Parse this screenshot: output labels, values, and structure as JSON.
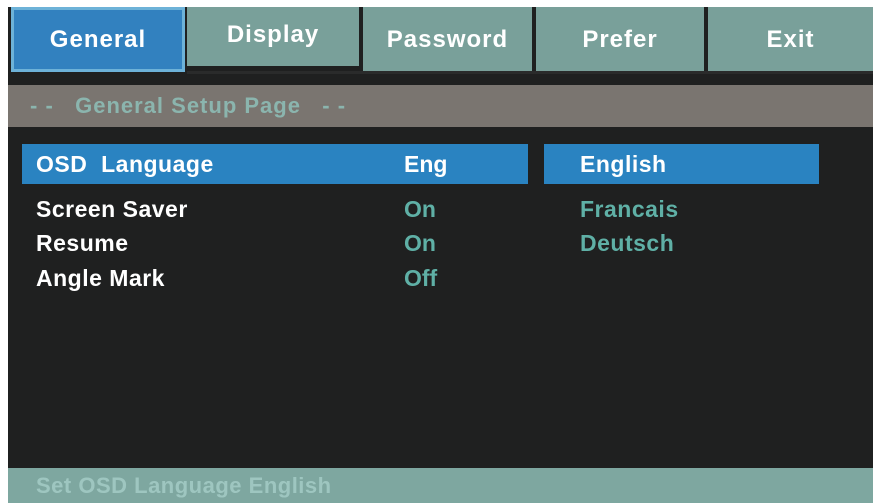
{
  "tabs": [
    {
      "label": "General",
      "active": true
    },
    {
      "label": "Display",
      "active": false
    },
    {
      "label": "Password",
      "active": false
    },
    {
      "label": "Prefer",
      "active": false
    },
    {
      "label": "Exit",
      "active": false
    }
  ],
  "page_header": "- -   General Setup Page   - -",
  "settings": [
    {
      "label": "OSD  Language",
      "value": "Eng",
      "selected": true
    },
    {
      "label": "Screen Saver",
      "value": "On",
      "selected": false
    },
    {
      "label": "Resume",
      "value": "On",
      "selected": false
    },
    {
      "label": "Angle Mark",
      "value": "Off",
      "selected": false
    }
  ],
  "options": [
    {
      "label": "English",
      "selected": true
    },
    {
      "label": "Francais",
      "selected": false
    },
    {
      "label": "Deutsch",
      "selected": false
    }
  ],
  "status_text": "Set OSD Language English",
  "colors": {
    "background": "#1f2020",
    "active_tab": "#3281bf",
    "inactive_tab": "#79a09a",
    "header_bar": "#7a7570",
    "highlight": "#2a83c1",
    "value_text": "#5fb0a6",
    "status_bar": "#7ea7a0"
  }
}
